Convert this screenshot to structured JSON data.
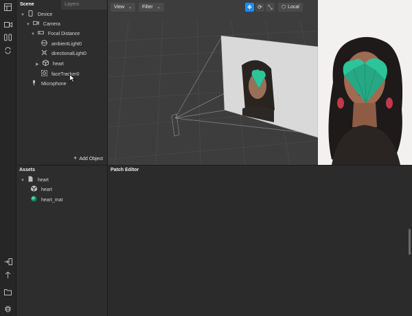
{
  "scene_panel": {
    "tabs": [
      {
        "label": "Scene",
        "active": true
      },
      {
        "label": "Layers",
        "active": false
      }
    ],
    "tree": [
      {
        "label": "Device",
        "icon": "device-icon",
        "depth": 0,
        "expanded": true
      },
      {
        "label": "Camera",
        "icon": "camera-icon",
        "depth": 1,
        "expanded": true
      },
      {
        "label": "Focal Distance",
        "icon": "focal-distance-icon",
        "depth": 2,
        "expanded": true
      },
      {
        "label": "ambientLight0",
        "icon": "ambient-light-icon",
        "depth": 3
      },
      {
        "label": "directionalLight0",
        "icon": "directional-light-icon",
        "depth": 3
      },
      {
        "label": "heart",
        "icon": "cube-icon",
        "depth": 3,
        "expanded": false
      },
      {
        "label": "faceTracker0",
        "icon": "face-tracker-icon",
        "depth": 3
      },
      {
        "label": "Microphone",
        "icon": "microphone-icon",
        "depth": 1
      }
    ],
    "add_object_label": "Add Object"
  },
  "viewport": {
    "view_label": "View",
    "filter_label": "Filter",
    "coord_space_label": "Local",
    "tools": [
      "move-icon",
      "rotate-icon",
      "scale-icon"
    ],
    "active_tool": "move-icon"
  },
  "assets_panel": {
    "title": "Assets",
    "items": [
      {
        "label": "heart",
        "icon": "file-icon",
        "depth": 0,
        "expanded": true
      },
      {
        "label": "heart",
        "icon": "cube-icon",
        "depth": 1
      },
      {
        "label": "heart_mat",
        "icon": "material-sphere-icon",
        "depth": 1
      }
    ]
  },
  "patch_editor": {
    "title": "Patch Editor"
  },
  "colors": {
    "accent_blue": "#1f8ce6",
    "heart_green": "#2ec49a",
    "panel_bg": "#2d2d2d",
    "viewport_bg": "#3d3d3d"
  }
}
